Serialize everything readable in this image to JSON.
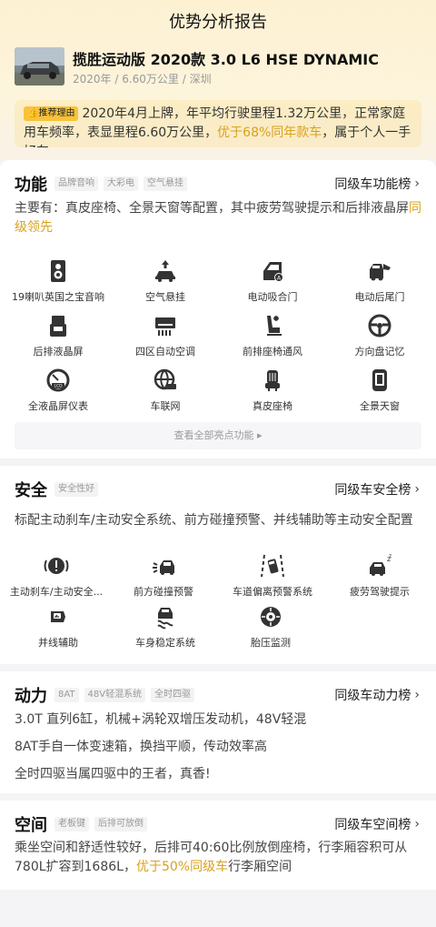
{
  "page_title": "优势分析报告",
  "car": {
    "name": "揽胜运动版 2020款 3.0 L6 HSE DYNAMIC",
    "meta": "2020年 / 6.60万公里 / 深圳"
  },
  "recommend": {
    "tag": "推荐理由",
    "text_a": "2020年4月上牌，年平均行驶里程1.32万公里，正常家庭用车频率，表显里程6.60万公里，",
    "highlight": "优于68%同年款车",
    "text_b": "，属于个人一手好车"
  },
  "features": {
    "title": "功能",
    "tags": [
      "品牌音响",
      "大彩电",
      "空气悬挂"
    ],
    "rank_label": "同级车功能榜",
    "desc_a": "主要有：真皮座椅、全景天窗等配置，其中疲劳驾驶提示和后排液晶屏",
    "desc_hl": "同级领先",
    "items": [
      {
        "label": "19喇叭英国之宝音响",
        "icon": "speaker-icon"
      },
      {
        "label": "空气悬挂",
        "icon": "air-suspension-icon"
      },
      {
        "label": "电动吸合门",
        "icon": "soft-close-door-icon"
      },
      {
        "label": "电动后尾门",
        "icon": "power-tailgate-icon"
      },
      {
        "label": "后排液晶屏",
        "icon": "rear-screen-icon"
      },
      {
        "label": "四区自动空调",
        "icon": "climate-control-icon"
      },
      {
        "label": "前排座椅通风",
        "icon": "seat-ventilation-icon"
      },
      {
        "label": "方向盘记忆",
        "icon": "steering-memory-icon"
      },
      {
        "label": "全液晶屏仪表",
        "icon": "lcd-cluster-icon"
      },
      {
        "label": "车联网",
        "icon": "connected-car-icon"
      },
      {
        "label": "真皮座椅",
        "icon": "leather-seat-icon"
      },
      {
        "label": "全景天窗",
        "icon": "panoramic-sunroof-icon"
      }
    ],
    "more_label": "查看全部亮点功能"
  },
  "safety": {
    "title": "安全",
    "tags": [
      "安全性好"
    ],
    "rank_label": "同级车安全榜",
    "desc": "标配主动刹车/主动安全系统、前方碰撞预警、并线辅助等主动安全配置",
    "items": [
      {
        "label": "主动刹车/主动安全...",
        "icon": "active-brake-icon"
      },
      {
        "label": "前方碰撞预警",
        "icon": "collision-warning-icon"
      },
      {
        "label": "车道偏离预警系统",
        "icon": "lane-departure-icon"
      },
      {
        "label": "疲劳驾驶提示",
        "icon": "fatigue-alert-icon"
      },
      {
        "label": "并线辅助",
        "icon": "blind-spot-icon"
      },
      {
        "label": "车身稳定系统",
        "icon": "stability-control-icon"
      },
      {
        "label": "胎压监测",
        "icon": "tire-pressure-icon"
      }
    ]
  },
  "power": {
    "title": "动力",
    "tags": [
      "8AT",
      "48V轻混系统",
      "全时四驱"
    ],
    "rank_label": "同级车动力榜",
    "lines": [
      "3.0T 直列6缸，机械+涡轮双增压发动机，48V轻混",
      "8AT手自一体变速箱，换挡平顺，传动效率高",
      "全时四驱当属四驱中的王者，真香!"
    ]
  },
  "space": {
    "title": "空间",
    "tags": [
      "老板键",
      "后排可放倒"
    ],
    "rank_label": "同级车空间榜",
    "desc_a": "乘坐空间和舒适性较好，后排可40:60比例放倒座椅，行李厢容积可从780L扩容到1686L，",
    "desc_hl": "优于50%同级车",
    "desc_b": "行李厢空间"
  },
  "colors": {
    "accent": "#d9a11f",
    "tag_yellow": "#f8c23a",
    "header_bg": "#fdf1d2"
  }
}
